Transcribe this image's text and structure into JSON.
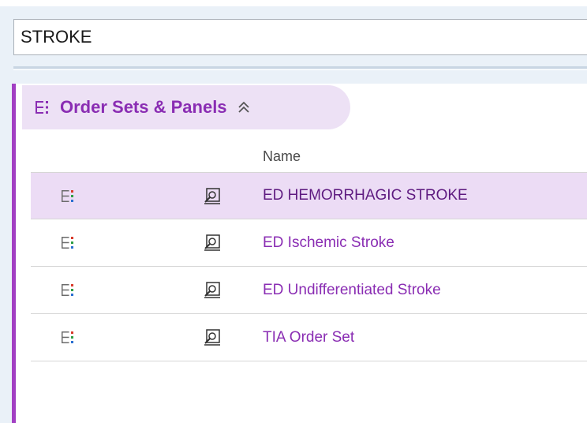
{
  "search": {
    "value": "STROKE"
  },
  "section": {
    "title": "Order Sets & Panels",
    "header_icon": "order-set-icon",
    "collapse_icon": "double-chevron-up-icon",
    "accent_color": "#a23fc3",
    "title_color": "#8a2db3",
    "header_bg": "#ede1f5"
  },
  "table": {
    "columns": [
      "Name"
    ],
    "rows": [
      {
        "name": "ED HEMORRHAGIC STROKE",
        "selected": true
      },
      {
        "name": "ED Ischemic Stroke",
        "selected": false
      },
      {
        "name": "ED Undifferentiated Stroke",
        "selected": false
      },
      {
        "name": "TIA Order Set",
        "selected": false
      }
    ],
    "row_icons": [
      "order-set-icon",
      "preview-icon"
    ],
    "selected_row_bg": "#ecdcf5"
  }
}
